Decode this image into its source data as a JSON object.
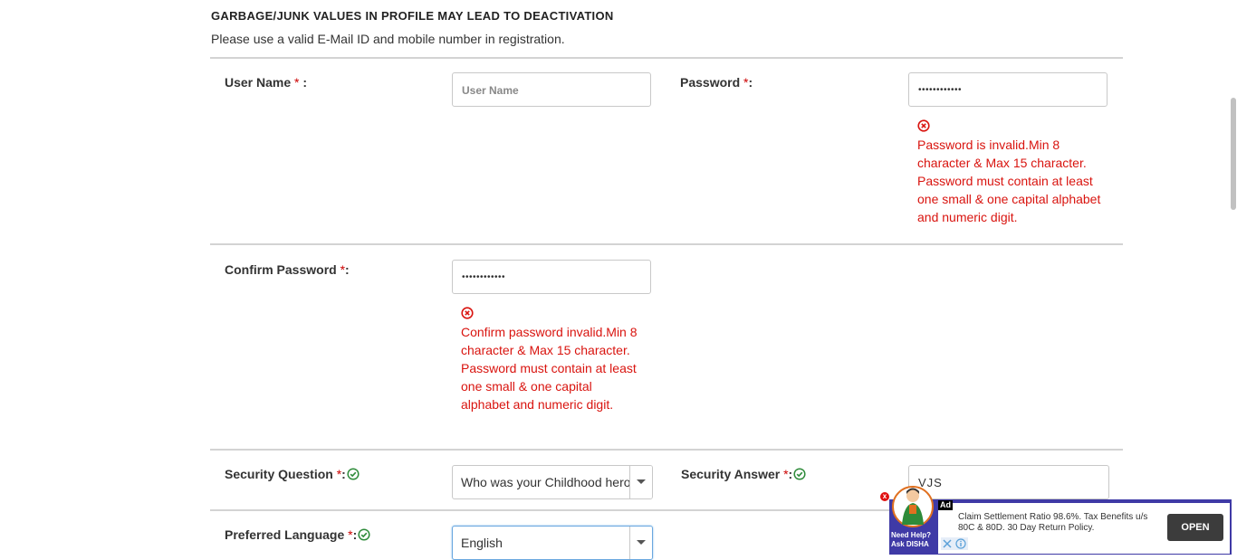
{
  "header": {
    "warning": "GARBAGE/JUNK VALUES IN PROFILE MAY LEAD TO DEACTIVATION",
    "note": "Please use a valid E-Mail ID and mobile number in registration."
  },
  "form": {
    "username": {
      "label": "User Name",
      "required_mark": "*",
      "suffix": " :",
      "placeholder": "User Name"
    },
    "password": {
      "label": "Password",
      "required_mark": "*",
      "suffix": ":",
      "value": "••••••••••••",
      "error": "Password is invalid.Min 8 character & Max 15 character. Password must contain at least one small & one capital alphabet and numeric digit."
    },
    "confirm_password": {
      "label": "Confirm Password",
      "required_mark": "*",
      "suffix": ":",
      "value": "••••••••••••",
      "error": "Confirm password invalid.Min 8 character & Max 15 character. Password must contain at least one small & one capital alphabet and numeric digit."
    },
    "security_question": {
      "label": "Security Question",
      "required_mark": "*",
      "suffix": ":",
      "value": "Who was your Childhood hero?"
    },
    "security_answer": {
      "label": "Security Answer",
      "required_mark": "*",
      "suffix": ":",
      "value": "VJS"
    },
    "preferred_language": {
      "label": "Preferred Language",
      "required_mark": "*",
      "suffix": ":",
      "value": "English"
    }
  },
  "ad": {
    "badge": "Ad",
    "text": "Claim Settlement Ratio 98.6%. Tax Benefits u/s 80C & 80D. 30 Day Return Policy.",
    "cta": "OPEN",
    "disha_label": "Need Help? Ask DISHA",
    "close": "x"
  },
  "colors": {
    "error": "#d9140f",
    "success": "#2e8b3a",
    "ad_bg": "#3f3aa6"
  }
}
